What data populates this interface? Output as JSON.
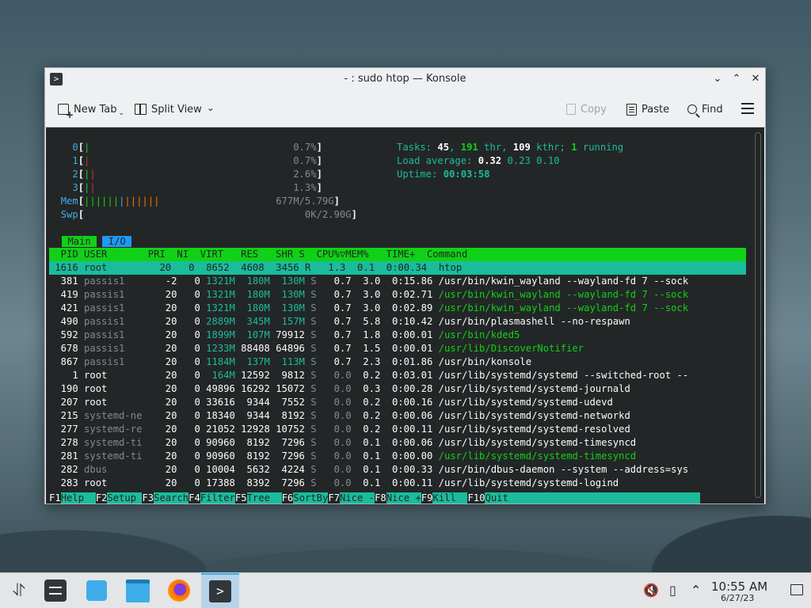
{
  "window": {
    "title": "- : sudo htop — Konsole",
    "app_icon": ">"
  },
  "toolbar": {
    "new_tab": "New Tab",
    "split_view": "Split View",
    "copy": "Copy",
    "paste": "Paste",
    "find": "Find"
  },
  "htop": {
    "cpu": [
      {
        "label": "0",
        "pct": "0.7%"
      },
      {
        "label": "1",
        "pct": "0.7%"
      },
      {
        "label": "2",
        "pct": "2.6%"
      },
      {
        "label": "3",
        "pct": "1.3%"
      }
    ],
    "mem": {
      "label": "Mem",
      "value": "677M/5.79G"
    },
    "swp": {
      "label": "Swp",
      "value": "0K/2.90G"
    },
    "tasks": {
      "label": "Tasks: ",
      "tasks": "45",
      "thr": "191",
      "kthr": "109",
      "running": "1"
    },
    "load": {
      "label": "Load average: ",
      "l1": "0.32",
      "l5": "0.23",
      "l15": "0.10"
    },
    "uptime": {
      "label": "Uptime: ",
      "value": "00:03:58"
    },
    "tabs": [
      "Main",
      "I/O"
    ],
    "columns": "  PID USER       PRI  NI  VIRT   RES   SHR S  CPU%▽MEM%   TIME+  Command",
    "selected_row": {
      "pid": "1616",
      "user": "root",
      "pri": "20",
      "ni": "0",
      "virt": "8652",
      "res": "4608",
      "shr": "3456",
      "s": "R",
      "cpu": "1.3",
      "mem": "0.1",
      "time": "0:00.34",
      "cmd": "htop"
    },
    "processes": [
      {
        "pid": "381",
        "user": "passis1",
        "pri": "-2",
        "ni": "0",
        "virt": "1321M",
        "res": "180M",
        "shr": "130M",
        "s": "S",
        "cpu": "0.7",
        "mem": "3.0",
        "time": "0:15.86",
        "cmd": "/usr/bin/kwin_wayland --wayland-fd 7 --sock",
        "thread": false
      },
      {
        "pid": "419",
        "user": "passis1",
        "pri": "20",
        "ni": "0",
        "virt": "1321M",
        "res": "180M",
        "shr": "130M",
        "s": "S",
        "cpu": "0.7",
        "mem": "3.0",
        "time": "0:02.71",
        "cmd": "/usr/bin/kwin_wayland --wayland-fd 7 --sock",
        "thread": true
      },
      {
        "pid": "421",
        "user": "passis1",
        "pri": "20",
        "ni": "0",
        "virt": "1321M",
        "res": "180M",
        "shr": "130M",
        "s": "S",
        "cpu": "0.7",
        "mem": "3.0",
        "time": "0:02.89",
        "cmd": "/usr/bin/kwin_wayland --wayland-fd 7 --sock",
        "thread": true
      },
      {
        "pid": "490",
        "user": "passis1",
        "pri": "20",
        "ni": "0",
        "virt": "2889M",
        "res": "345M",
        "shr": "157M",
        "s": "S",
        "cpu": "0.7",
        "mem": "5.8",
        "time": "0:10.42",
        "cmd": "/usr/bin/plasmashell --no-respawn",
        "thread": false
      },
      {
        "pid": "592",
        "user": "passis1",
        "pri": "20",
        "ni": "0",
        "virt": "1899M",
        "res": "107M",
        "shr": "79912",
        "s": "S",
        "cpu": "0.7",
        "mem": "1.8",
        "time": "0:00.01",
        "cmd": "/usr/bin/kded5",
        "thread": true
      },
      {
        "pid": "678",
        "user": "passis1",
        "pri": "20",
        "ni": "0",
        "virt": "1233M",
        "res": "88408",
        "shr": "64896",
        "s": "S",
        "cpu": "0.7",
        "mem": "1.5",
        "time": "0:00.01",
        "cmd": "/usr/lib/DiscoverNotifier",
        "thread": true
      },
      {
        "pid": "867",
        "user": "passis1",
        "pri": "20",
        "ni": "0",
        "virt": "1184M",
        "res": "137M",
        "shr": "113M",
        "s": "S",
        "cpu": "0.7",
        "mem": "2.3",
        "time": "0:01.86",
        "cmd": "/usr/bin/konsole",
        "thread": false
      },
      {
        "pid": "1",
        "user": "root",
        "pri": "20",
        "ni": "0",
        "virt": "164M",
        "res": "12592",
        "shr": "9812",
        "s": "S",
        "cpu": "0.0",
        "mem": "0.2",
        "time": "0:03.01",
        "cmd": "/usr/lib/systemd/systemd --switched-root --",
        "thread": false
      },
      {
        "pid": "190",
        "user": "root",
        "pri": "20",
        "ni": "0",
        "virt": "49896",
        "res": "16292",
        "shr": "15072",
        "s": "S",
        "cpu": "0.0",
        "mem": "0.3",
        "time": "0:00.28",
        "cmd": "/usr/lib/systemd/systemd-journald",
        "thread": false
      },
      {
        "pid": "207",
        "user": "root",
        "pri": "20",
        "ni": "0",
        "virt": "33616",
        "res": "9344",
        "shr": "7552",
        "s": "S",
        "cpu": "0.0",
        "mem": "0.2",
        "time": "0:00.16",
        "cmd": "/usr/lib/systemd/systemd-udevd",
        "thread": false
      },
      {
        "pid": "215",
        "user": "systemd-ne",
        "pri": "20",
        "ni": "0",
        "virt": "18340",
        "res": "9344",
        "shr": "8192",
        "s": "S",
        "cpu": "0.0",
        "mem": "0.2",
        "time": "0:00.06",
        "cmd": "/usr/lib/systemd/systemd-networkd",
        "thread": false
      },
      {
        "pid": "277",
        "user": "systemd-re",
        "pri": "20",
        "ni": "0",
        "virt": "21052",
        "res": "12928",
        "shr": "10752",
        "s": "S",
        "cpu": "0.0",
        "mem": "0.2",
        "time": "0:00.11",
        "cmd": "/usr/lib/systemd/systemd-resolved",
        "thread": false
      },
      {
        "pid": "278",
        "user": "systemd-ti",
        "pri": "20",
        "ni": "0",
        "virt": "90960",
        "res": "8192",
        "shr": "7296",
        "s": "S",
        "cpu": "0.0",
        "mem": "0.1",
        "time": "0:00.06",
        "cmd": "/usr/lib/systemd/systemd-timesyncd",
        "thread": false
      },
      {
        "pid": "281",
        "user": "systemd-ti",
        "pri": "20",
        "ni": "0",
        "virt": "90960",
        "res": "8192",
        "shr": "7296",
        "s": "S",
        "cpu": "0.0",
        "mem": "0.1",
        "time": "0:00.00",
        "cmd": "/usr/lib/systemd/systemd-timesyncd",
        "thread": true
      },
      {
        "pid": "282",
        "user": "dbus",
        "pri": "20",
        "ni": "0",
        "virt": "10004",
        "res": "5632",
        "shr": "4224",
        "s": "S",
        "cpu": "0.0",
        "mem": "0.1",
        "time": "0:00.33",
        "cmd": "/usr/bin/dbus-daemon --system --address=sys",
        "thread": false
      },
      {
        "pid": "283",
        "user": "root",
        "pri": "20",
        "ni": "0",
        "virt": "17388",
        "res": "8392",
        "shr": "7296",
        "s": "S",
        "cpu": "0.0",
        "mem": "0.1",
        "time": "0:00.11",
        "cmd": "/usr/lib/systemd/systemd-logind",
        "thread": false
      }
    ],
    "function_keys": [
      {
        "key": "F1",
        "label": "Help  "
      },
      {
        "key": "F2",
        "label": "Setup "
      },
      {
        "key": "F3",
        "label": "Search"
      },
      {
        "key": "F4",
        "label": "Filter"
      },
      {
        "key": "F5",
        "label": "Tree  "
      },
      {
        "key": "F6",
        "label": "SortBy"
      },
      {
        "key": "F7",
        "label": "Nice -"
      },
      {
        "key": "F8",
        "label": "Nice +"
      },
      {
        "key": "F9",
        "label": "Kill  "
      },
      {
        "key": "F10",
        "label": "Quit"
      }
    ]
  },
  "taskbar": {
    "apps": [
      "launcher-icon",
      "system-settings-icon",
      "discover-icon",
      "dolphin-icon",
      "firefox-icon",
      "konsole-icon"
    ],
    "clock_time": "10:55 AM",
    "clock_date": "6/27/23"
  },
  "colors": {
    "terminal_bg": "#232627",
    "header_green": "#11d116",
    "cyan": "#1abc9c",
    "accent_blue": "#3daee9"
  }
}
